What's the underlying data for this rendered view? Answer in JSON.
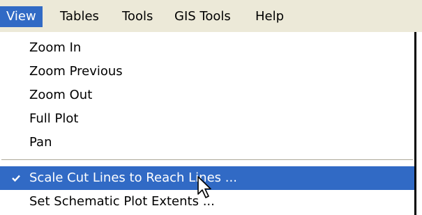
{
  "menubar": {
    "items": [
      {
        "label": "View",
        "active": true
      },
      {
        "label": "Tables"
      },
      {
        "label": "Tools"
      },
      {
        "label": "GIS Tools"
      },
      {
        "label": "Help"
      }
    ]
  },
  "view_menu": {
    "items": [
      {
        "label": "Zoom In"
      },
      {
        "label": "Zoom Previous"
      },
      {
        "label": "Zoom Out"
      },
      {
        "label": "Full Plot"
      },
      {
        "label": "Pan"
      },
      {
        "label": "Scale Cut Lines to Reach Lines ...",
        "checked": true,
        "highlighted": true
      },
      {
        "label": "Set Schematic Plot Extents ..."
      }
    ]
  },
  "icons": {
    "check": "check-icon",
    "cursor": "mouse-pointer-icon"
  },
  "colors": {
    "highlight": "#316ac5",
    "menubar_bg": "#ece9d8",
    "menu_bg": "#ffffff"
  }
}
